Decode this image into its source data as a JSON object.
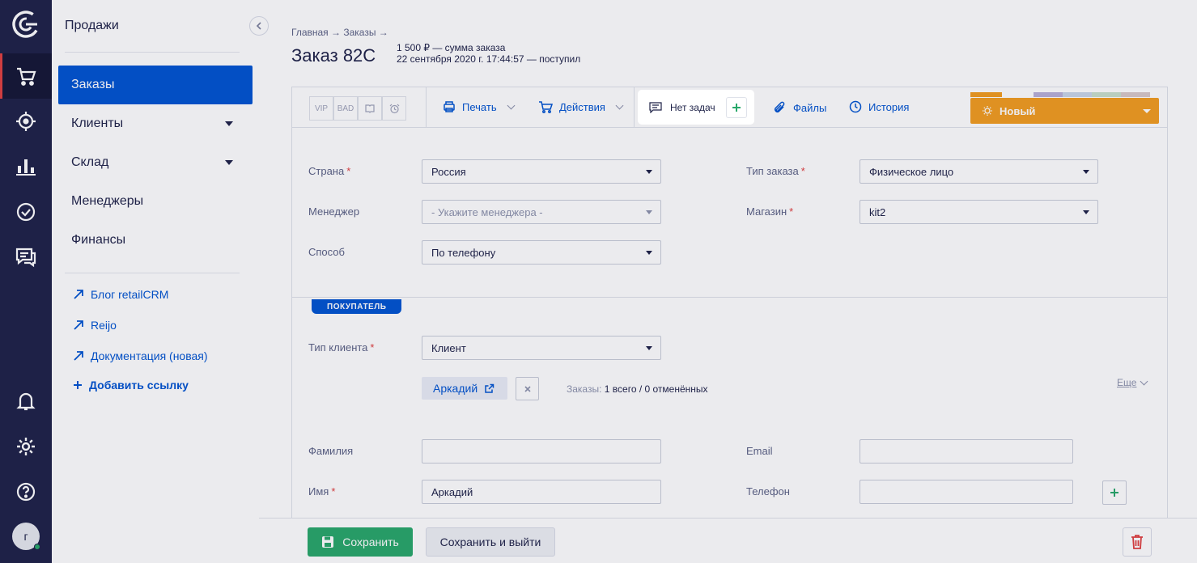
{
  "rail": {
    "avatar_letter": "г",
    "icons": [
      "logo-icon",
      "cart-icon",
      "target-icon",
      "chart-icon",
      "check-icon",
      "chat-icon",
      "bell-icon",
      "gear-icon",
      "help-icon"
    ]
  },
  "sidebar": {
    "title": "Продажи",
    "items": [
      {
        "label": "Заказы",
        "active": true
      },
      {
        "label": "Клиенты"
      },
      {
        "label": "Склад"
      },
      {
        "label": "Менеджеры"
      },
      {
        "label": "Финансы"
      }
    ],
    "links": [
      {
        "label": "Блог retailCRM"
      },
      {
        "label": "Reijo"
      },
      {
        "label": "Документация (новая)"
      },
      {
        "label": "Добавить ссылку"
      }
    ]
  },
  "header": {
    "breadcrumb": "Главная → Заказы →",
    "title": "Заказ 82C",
    "sum_value": "1 500 ₽",
    "sum_label": "сумма заказа",
    "date_value": "22 сентября 2020 г. 17:44:57",
    "date_label": "поступил"
  },
  "toolbar": {
    "tags": [
      "VIP",
      "BAD"
    ],
    "print": "Печать",
    "actions": "Действия",
    "tasks": "Нет задач",
    "files": "Файлы",
    "history": "История",
    "status": "Новый",
    "status_color": "#f29d1f"
  },
  "form": {
    "country_label": "Страна",
    "country": "Россия",
    "manager_label": "Менеджер",
    "manager_placeholder": "- Укажите менеджера -",
    "method_label": "Способ",
    "method": "По телефону",
    "order_type_label": "Тип заказа",
    "order_type": "Физическое лицо",
    "shop_label": "Магазин",
    "shop": "kit2"
  },
  "buyer": {
    "section": "ПОКУПАТЕЛЬ",
    "client_type_label": "Тип клиента",
    "client_type": "Клиент",
    "client_name": "Аркадий",
    "orders_label": "Заказы:",
    "orders_value": "1 всего / 0 отменённых",
    "more": "Еще",
    "lastname_label": "Фамилия",
    "lastname": "",
    "firstname_label": "Имя",
    "firstname": "Аркадий",
    "email_label": "Email",
    "email": "",
    "phone_label": "Телефон",
    "phone": ""
  },
  "footer": {
    "save": "Сохранить",
    "save_exit": "Сохранить и выйти"
  }
}
